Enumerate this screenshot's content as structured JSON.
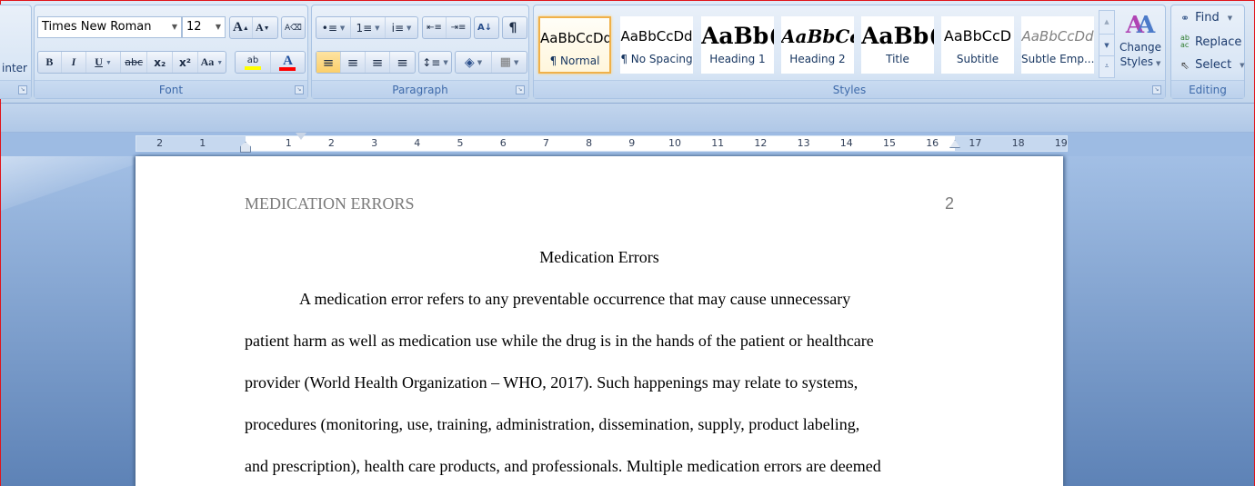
{
  "ribbon": {
    "clipboard": {
      "format_painter_partial": "inter"
    },
    "font": {
      "label": "Font",
      "font_name": "Times New Roman",
      "font_size": "12",
      "grow_font": "A",
      "shrink_font": "A",
      "clear_format": "A⌫",
      "bold": "B",
      "italic": "I",
      "underline": "U",
      "strikethrough": "abc",
      "subscript": "x₂",
      "superscript": "x²",
      "change_case": "Aa",
      "highlight": "ab",
      "font_color": "A",
      "highlight_color": "#ffff00",
      "font_color_value": "#ff0000"
    },
    "paragraph": {
      "label": "Paragraph",
      "bullets": "•≡",
      "numbering": "1≡",
      "multilevel": "i≡",
      "decrease_indent": "⇤≡",
      "increase_indent": "⇥≡",
      "sort": "A↓",
      "show_marks": "¶",
      "align_left": "≡",
      "align_center": "≡",
      "align_right": "≡",
      "justify": "≡",
      "line_spacing": "↕≡",
      "shading": "◈",
      "borders": "▦"
    },
    "styles": {
      "label": "Styles",
      "items": [
        {
          "preview": "AaBbCcDd",
          "name": "¶ Normal"
        },
        {
          "preview": "AaBbCcDd",
          "name": "¶ No Spacing"
        },
        {
          "preview": "AaBb(",
          "name": "Heading 1"
        },
        {
          "preview": "AaBbCc",
          "name": "Heading 2"
        },
        {
          "preview": "AaBb(",
          "name": "Title"
        },
        {
          "preview": "AaBbCcD",
          "name": "Subtitle"
        },
        {
          "preview": "AaBbCcDd",
          "name": "Subtle Emp..."
        }
      ],
      "change_styles_line1": "Change",
      "change_styles_line2": "Styles"
    },
    "editing": {
      "label": "Editing",
      "find": "Find",
      "replace": "Replace",
      "select": "Select"
    }
  },
  "ruler": {
    "left_numbers": [
      "2",
      "1"
    ],
    "right_numbers": [
      "1",
      "2",
      "3",
      "4",
      "5",
      "6",
      "7",
      "8",
      "9",
      "10",
      "11",
      "12",
      "13",
      "14",
      "15",
      "16",
      "17",
      "18",
      "19"
    ]
  },
  "document": {
    "running_head": "MEDICATION ERRORS",
    "page_number": "2",
    "title": "Medication Errors",
    "lines": [
      "A medication error refers to any preventable occurrence that may cause unnecessary",
      "patient harm as well as medication use while the drug is in the hands of the patient or healthcare",
      "provider (World Health Organization – WHO, 2017). Such happenings may relate to systems,",
      "procedures (monitoring, use, training, administration, dissemination, supply, product labeling,",
      "and prescription), health care products, and professionals. Multiple medication errors are deemed"
    ]
  }
}
